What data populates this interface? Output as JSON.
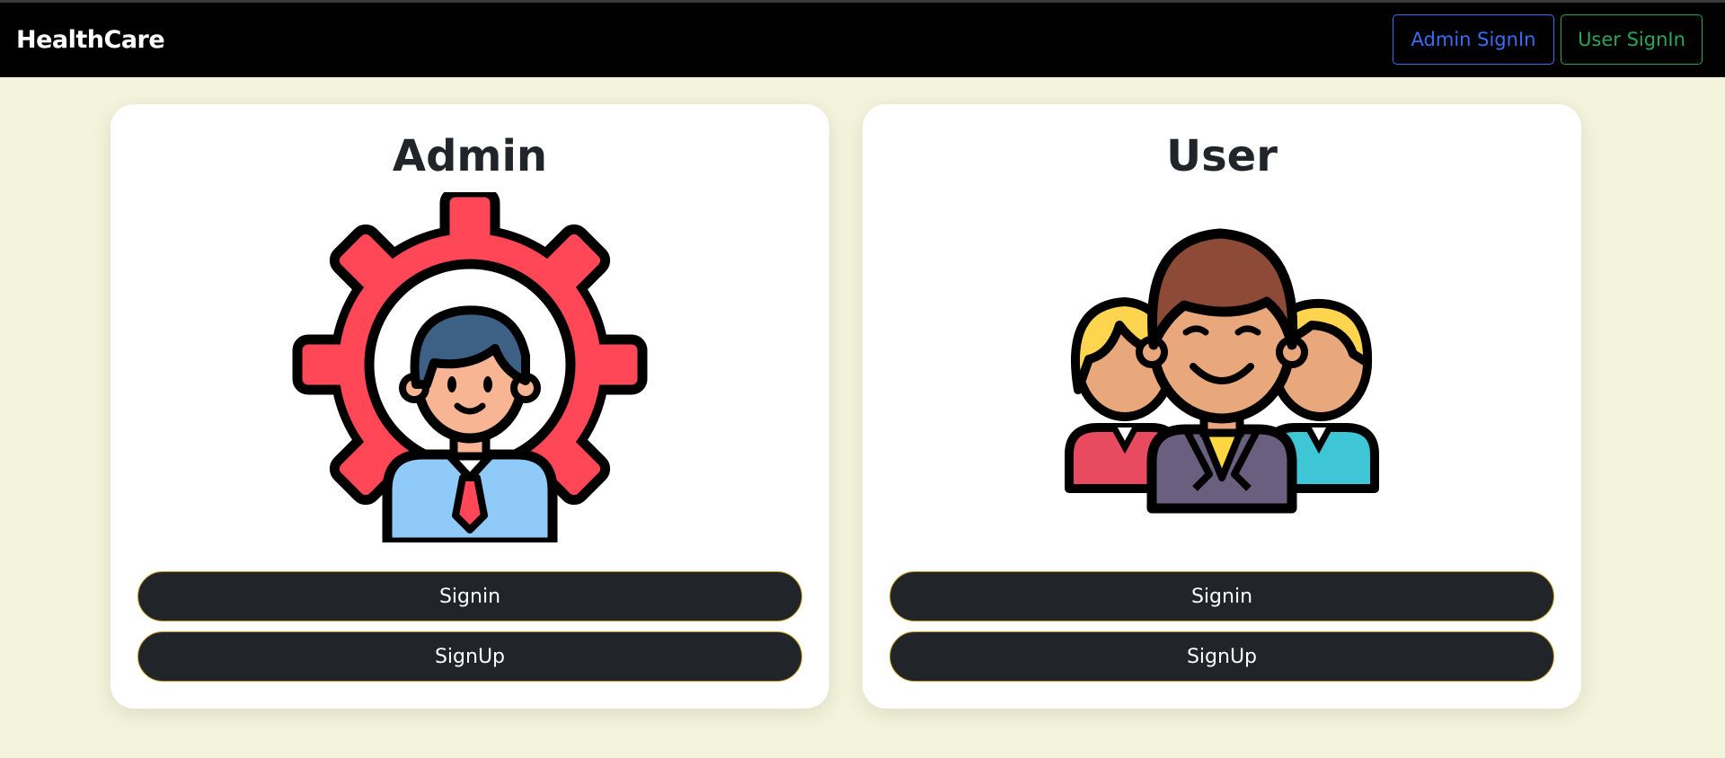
{
  "navbar": {
    "brand": "HealthCare",
    "admin_signin_label": "Admin SignIn",
    "user_signin_label": "User SignIn",
    "admin_color": "#3b6cf6",
    "user_color": "#2aa65a"
  },
  "cards": [
    {
      "title": "Admin",
      "icon": "admin-gear-person-icon",
      "signin_label": "Signin",
      "signup_label": "SignUp"
    },
    {
      "title": "User",
      "icon": "user-group-icon",
      "signin_label": "Signin",
      "signup_label": "SignUp"
    }
  ],
  "colors": {
    "page_background": "#f4f4dc",
    "navbar_background": "#000000",
    "card_background": "#ffffff",
    "button_background": "#212529",
    "button_border": "#c9a227"
  }
}
